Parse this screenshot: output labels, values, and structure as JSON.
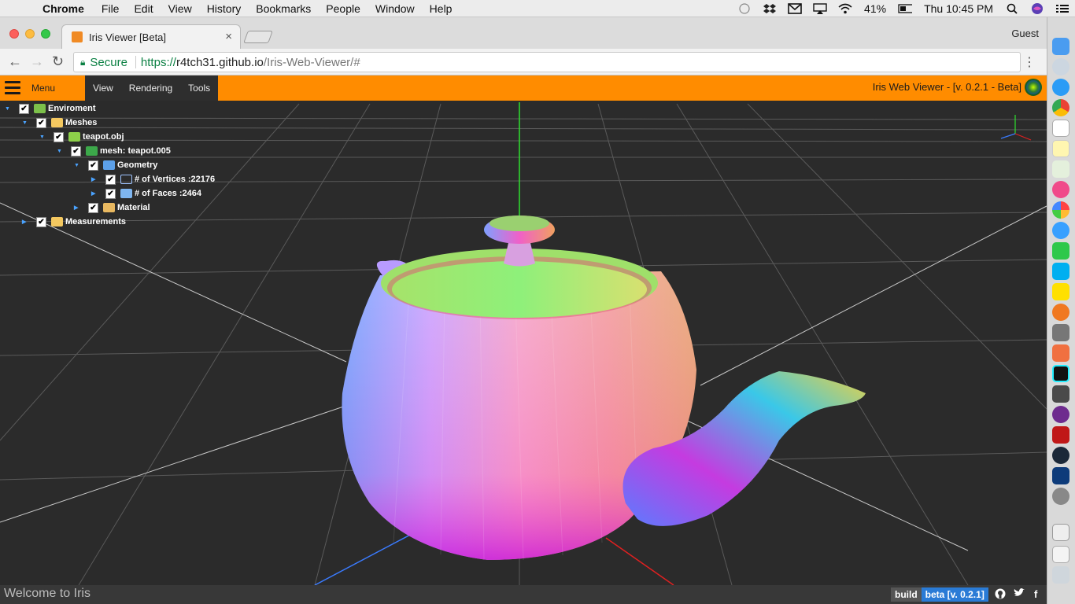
{
  "menubar": {
    "app_name": "Chrome",
    "items": [
      "File",
      "Edit",
      "View",
      "History",
      "Bookmarks",
      "People",
      "Window",
      "Help"
    ],
    "battery": "41%",
    "clock": "Thu 10:45 PM"
  },
  "browser": {
    "tab_title": "Iris Viewer [Beta]",
    "tab_close": "×",
    "profile": "Guest",
    "secure_label": "Secure",
    "url_scheme": "https://",
    "url_host": "r4tch31.github.io",
    "url_path": "/Iris-Web-Viewer/#"
  },
  "appbar": {
    "menu_label": "Menu",
    "tabs": [
      "View",
      "Rendering",
      "Tools"
    ],
    "title": "Iris Web Viewer - [v. 0.2.1 - Beta]"
  },
  "tree": [
    {
      "label": "Enviroment",
      "icon": "environment-icon",
      "arrow": "▼"
    },
    {
      "label": "Meshes",
      "icon": "folder-icon",
      "arrow": "▼"
    },
    {
      "label": "teapot.obj",
      "icon": "object-icon",
      "arrow": "▼"
    },
    {
      "label": "mesh: teapot.005",
      "icon": "mesh-icon",
      "arrow": "▼"
    },
    {
      "label": "Geometry",
      "icon": "geometry-icon",
      "arrow": "▼"
    },
    {
      "label": "# of Vertices :22176",
      "icon": "vertices-icon",
      "arrow": "▶"
    },
    {
      "label": "# of Faces :2464",
      "icon": "faces-icon",
      "arrow": "▶"
    },
    {
      "label": "Material",
      "icon": "material-icon",
      "arrow": "▶"
    },
    {
      "label": "Measurements",
      "icon": "folder-icon",
      "arrow": "▶"
    }
  ],
  "status": {
    "welcome": "Welcome to Iris",
    "build_label": "build",
    "build_version": "beta [v. 0.2.1]",
    "github": "⌥",
    "twitter": "t",
    "facebook": "f"
  },
  "colors": {
    "accent": "#ff8c00",
    "viewport_bg": "#2b2b2b",
    "badge_blue": "#2a7bd6"
  }
}
